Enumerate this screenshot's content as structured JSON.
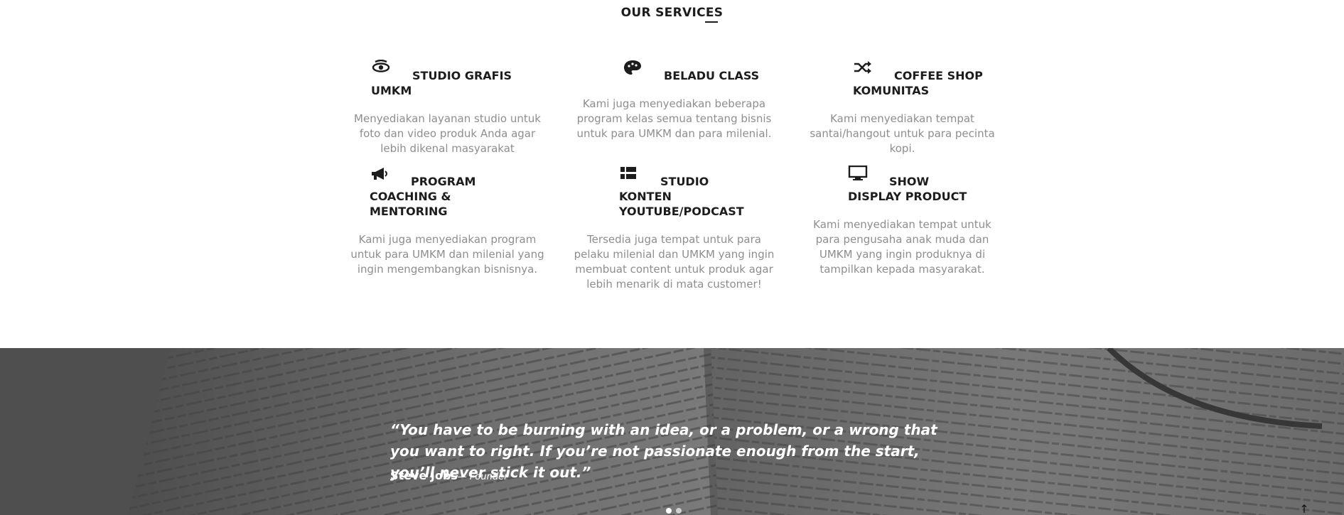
{
  "services_section": {
    "title": "OUR SERVICES",
    "items": [
      {
        "icon": "eye-icon",
        "title": "STUDIO GRAFIS UMKM",
        "desc": "Menyediakan layanan studio untuk foto dan video produk Anda agar lebih dikenal masyarakat"
      },
      {
        "icon": "palette-icon",
        "title": "BELADU CLASS",
        "desc": "Kami juga menyediakan beberapa program kelas semua tentang bisnis untuk para UMKM dan para milenial."
      },
      {
        "icon": "shuffle-icon",
        "title": "COFFEE SHOP KOMUNITAS",
        "desc": "Kami menyediakan tempat santai/hangout untuk para pecinta kopi."
      },
      {
        "icon": "megaphone-icon",
        "title": "PROGRAM COACHING & MENTORING",
        "desc": "Kami juga menyediakan program untuk para UMKM dan milenial yang ingin mengembangkan bisnisnya."
      },
      {
        "icon": "list-grid-icon",
        "title": "STUDIO KONTEN YOUTUBE/PODCAST",
        "desc": "Tersedia juga tempat untuk para pelaku milenial dan UMKM yang ingin membuat content untuk produk agar lebih menarik di mata customer!"
      },
      {
        "icon": "monitor-icon",
        "title": "SHOW DISPLAY PRODUCT",
        "desc": "Kami menyediakan tempat untuk para pengusaha anak muda dan UMKM yang ingin produknya di tampilkan kepada masyarakat."
      }
    ]
  },
  "testimonial": {
    "quote": "“You have to be burning with an idea, or a problem, or a wrong that you want to right. If you’re not passionate enough from the start, you’ll never stick it out.”",
    "author_name": "Steve Jobs",
    "author_role": "— Founder",
    "slide_count": 2,
    "active_slide": 1
  },
  "back_to_top": {
    "icon": "arrow-up-icon",
    "glyph": "↑"
  },
  "colors": {
    "heading": "#1c1c1c",
    "body_text": "#8e8e8e",
    "quote_overlay": "#6f6f6f",
    "white": "#ffffff"
  }
}
